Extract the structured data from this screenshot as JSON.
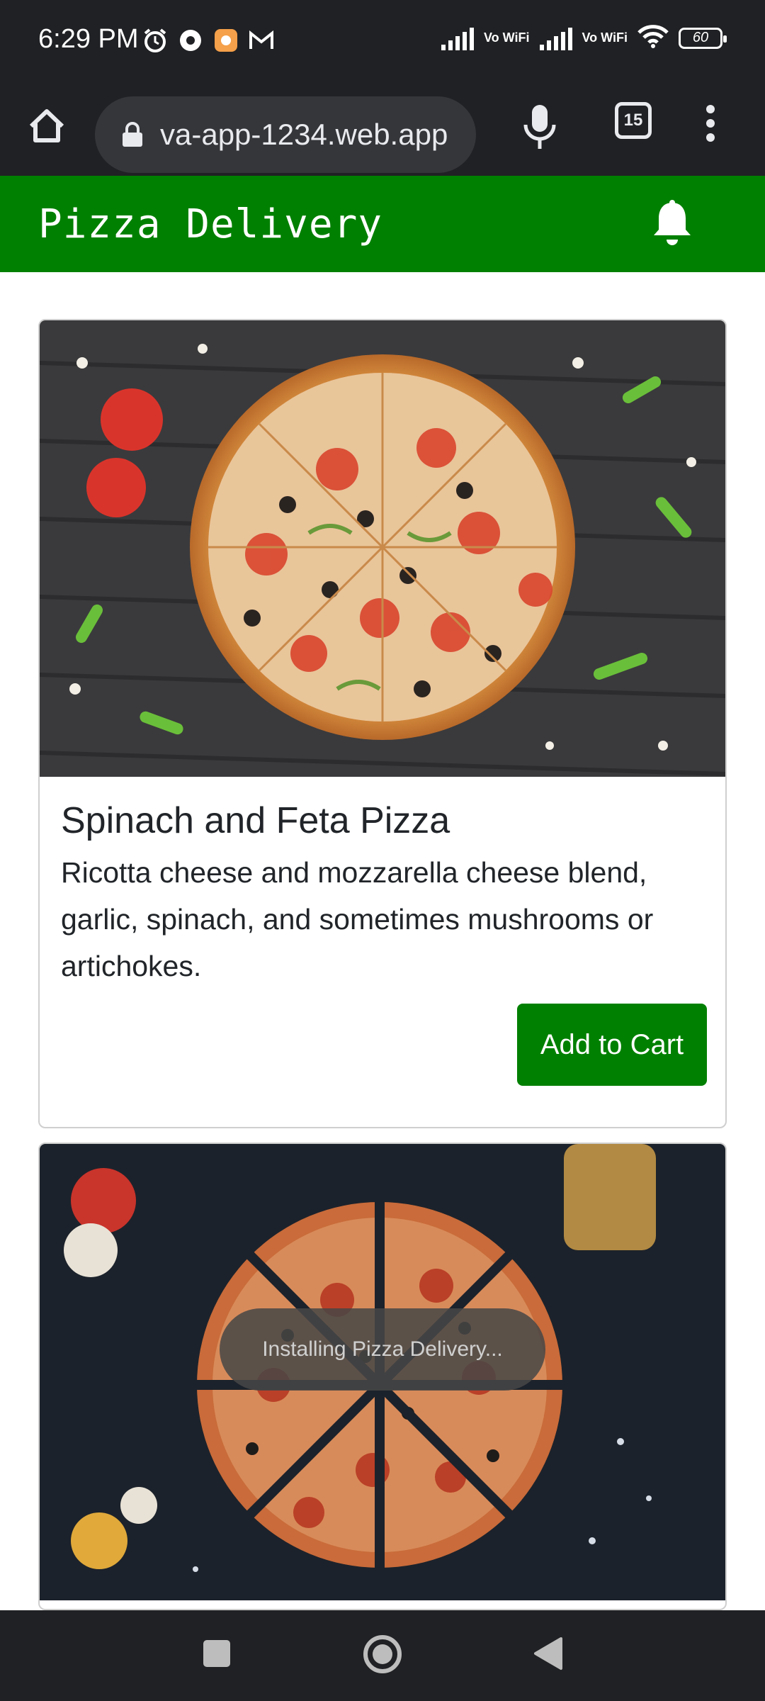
{
  "status_bar": {
    "time": "6:29 PM",
    "left_icons": [
      "alarm-icon",
      "chrome-icon",
      "mi-app-icon",
      "gmail-icon"
    ],
    "network_labels": [
      "Vo WiFi",
      "Vo WiFi"
    ],
    "battery": "60"
  },
  "browser": {
    "url": "va-app-1234.web.app",
    "tab_count": "15"
  },
  "app": {
    "title": "Pizza Delivery",
    "accent_color": "#008000"
  },
  "products": [
    {
      "name": "Spinach and Feta Pizza",
      "description": "Ricotta cheese and mozzarella cheese blend, garlic, spinach, and sometimes mushrooms or artichokes.",
      "button_label": "Add to Cart"
    }
  ],
  "toast": {
    "message": "Installing Pizza Delivery..."
  }
}
